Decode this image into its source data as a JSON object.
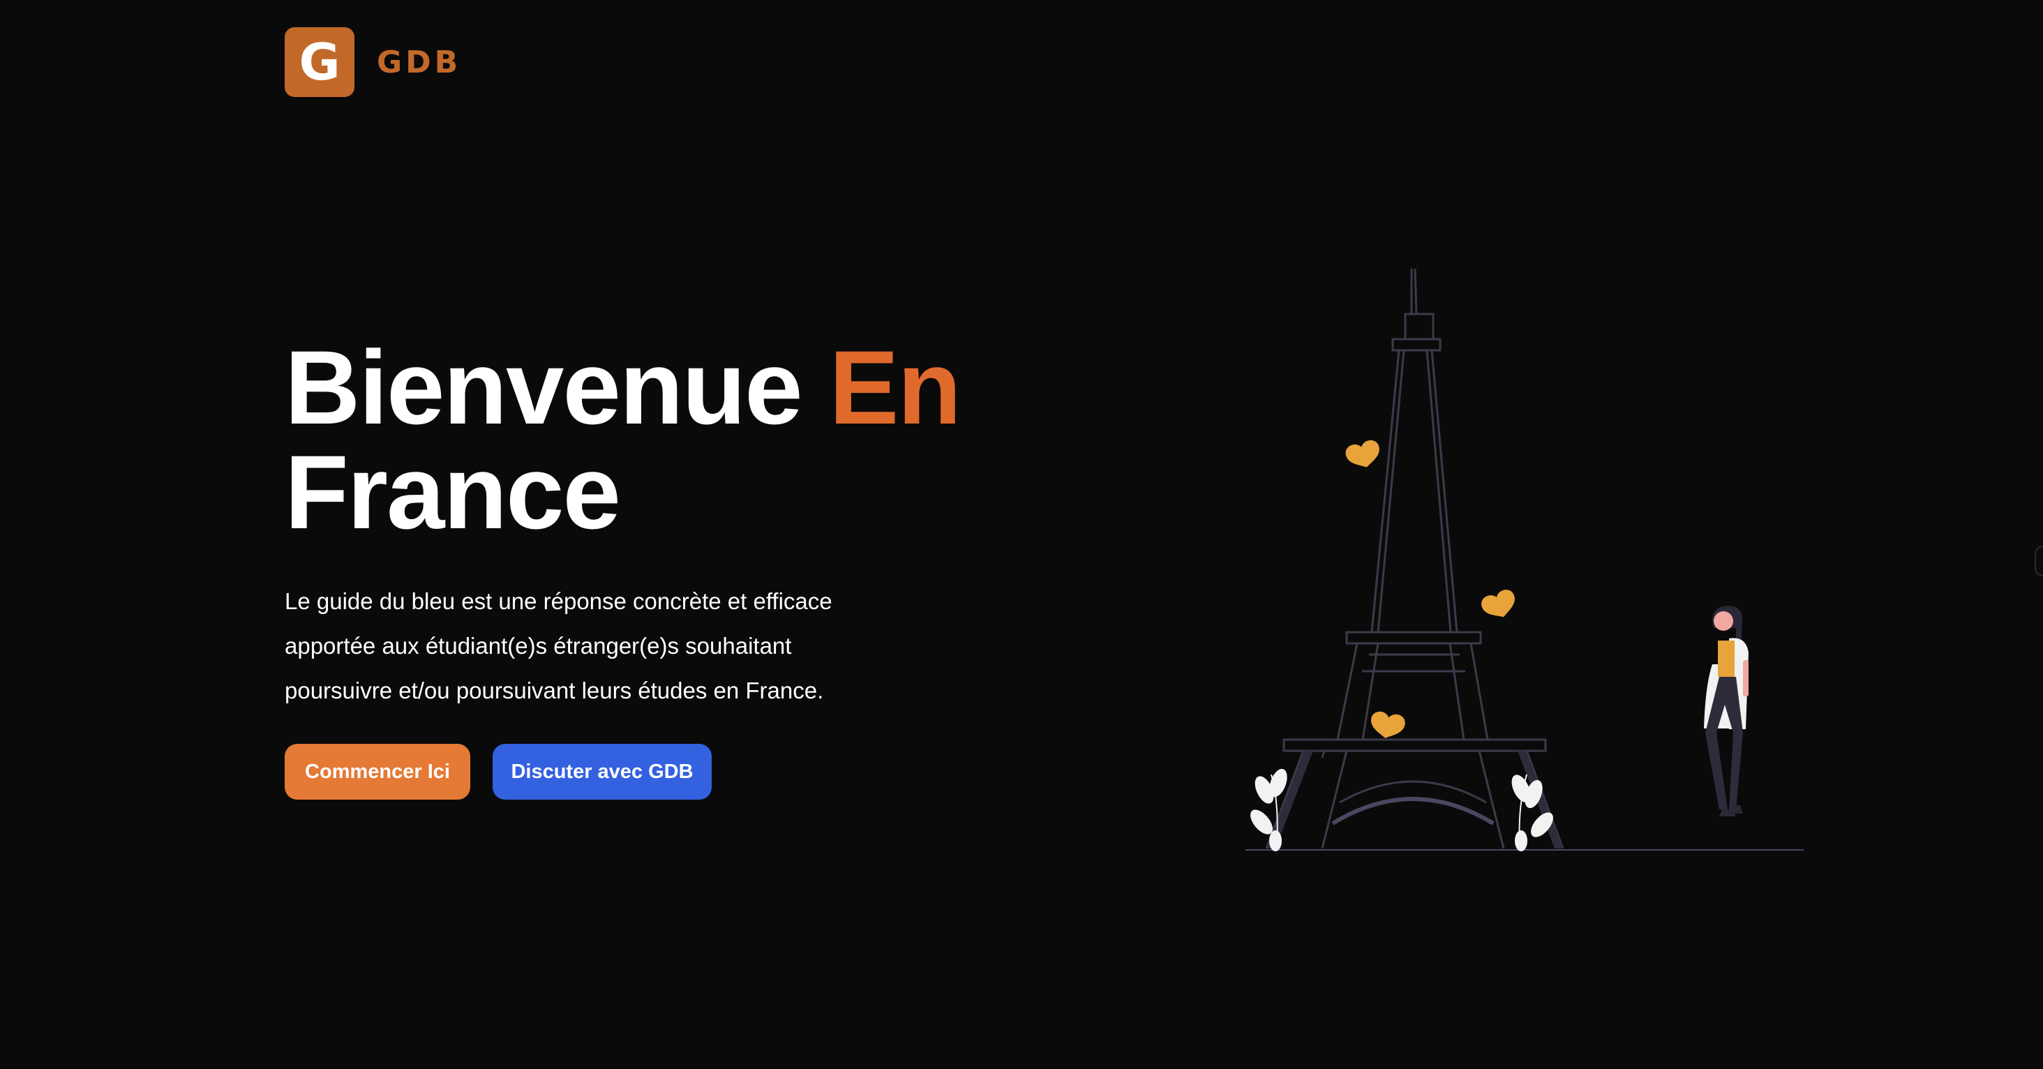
{
  "header": {
    "logo_letter": "G",
    "brand": "GDB"
  },
  "hero": {
    "title_part1": "Bienvenue ",
    "title_accent": "En",
    "title_part2": "France",
    "description": "Le guide du bleu est une réponse concrète et efficace apportée aux étudiant(e)s étranger(e)s souhaitant poursuivre et/ou poursuivant leurs études en France.",
    "buttons": {
      "start_label": "Commencer Ici",
      "chat_label": "Discuter avec GDB"
    }
  },
  "colors": {
    "background": "#0b0a0a",
    "brand": "#c2692a",
    "accent": "#e06a2c",
    "start_button": "#e47a35",
    "chat_button": "#3461e0",
    "heart": "#e8a33a"
  },
  "illustration": {
    "icon": "eiffel-tower-woman-illustration"
  }
}
